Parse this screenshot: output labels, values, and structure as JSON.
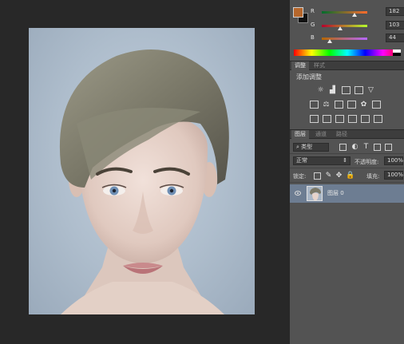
{
  "colors": {
    "foreground": "#b6672c",
    "background": "#111111",
    "accent_layer": "#6d7d92"
  },
  "color_panel": {
    "channels": [
      {
        "label": "R",
        "value": "182",
        "fraction": 0.714,
        "track": "linear-gradient(to right,#006c2c,#ff6c2c)"
      },
      {
        "label": "G",
        "value": "103",
        "fraction": 0.404,
        "track": "linear-gradient(to right,#b6002c,#b6ff2c)"
      },
      {
        "label": "B",
        "value": "44",
        "fraction": 0.173,
        "track": "linear-gradient(to right,#b66700,#b667ff)"
      }
    ]
  },
  "adjust_tabs": {
    "adjustments": "调整",
    "styles": "样式"
  },
  "adjustments": {
    "title": "添加调整"
  },
  "layer_tabs": {
    "layers": "图层",
    "channels": "通道",
    "paths": "路径"
  },
  "layers": {
    "filter_kind": "类型",
    "blend_mode": "正常",
    "opacity_label": "不透明度:",
    "opacity_value": "100%",
    "lock_label": "锁定:",
    "fill_label": "填充:",
    "fill_value": "100%",
    "items": [
      {
        "name": "图层 0",
        "visible": true
      }
    ]
  }
}
